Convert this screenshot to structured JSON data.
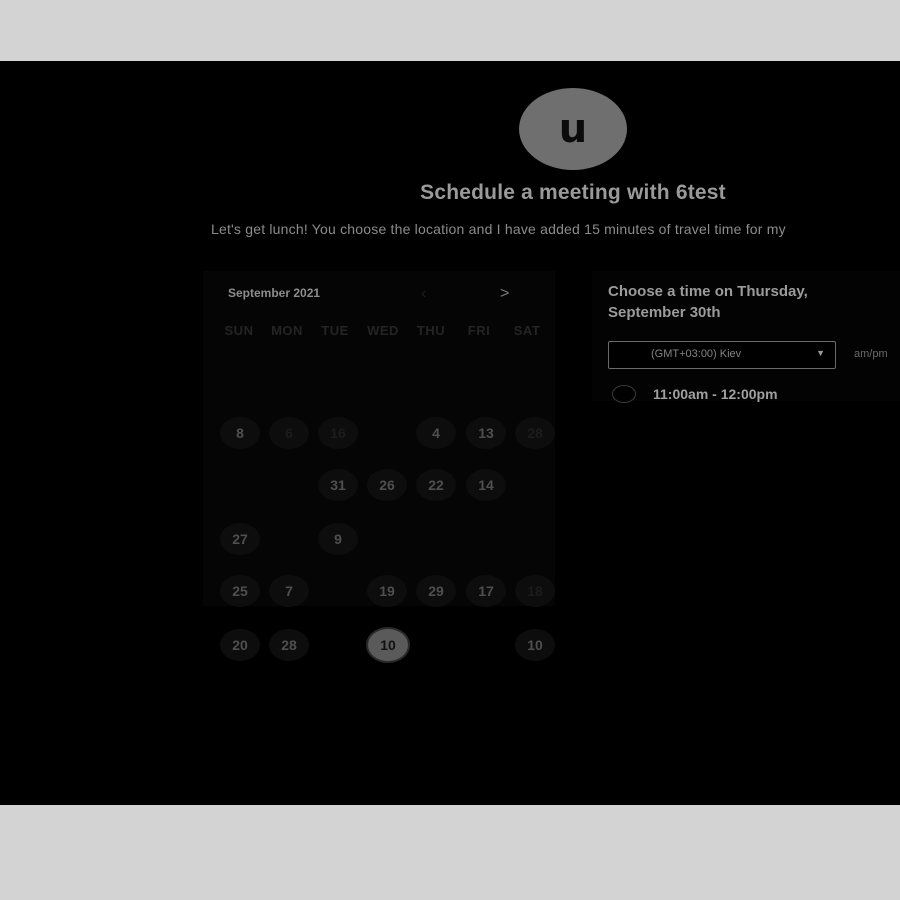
{
  "avatar": {
    "letter": "u"
  },
  "page": {
    "title": "Schedule a meeting with 6test",
    "description": "Let's get lunch! You choose the location and I have added 15 minutes of travel time for my"
  },
  "calendar": {
    "month_label": "September 2021",
    "prev_icon": "‹",
    "next_icon": ">",
    "weekdays": [
      "SUN",
      "MON",
      "TUE",
      "WED",
      "THU",
      "FRI",
      "SAT"
    ],
    "days": [
      [
        "8",
        "6",
        "16",
        "",
        "4",
        "13",
        "28"
      ],
      [
        "",
        "",
        "31",
        "26",
        "22",
        "14",
        ""
      ],
      [
        "27",
        "",
        "9",
        "",
        "",
        "",
        ""
      ],
      [
        "25",
        "7",
        "",
        "19",
        "29",
        "17",
        "18"
      ],
      [
        "20",
        "28",
        "",
        "10",
        "",
        "",
        "10"
      ]
    ],
    "selected_day": "10"
  },
  "time_picker": {
    "heading": "Choose a time on Thursday, September 30th",
    "timezone": "(GMT+03:00) Kiev",
    "format_toggle": "am/pm",
    "slots": [
      "11:00am - 12:00pm"
    ]
  },
  "colors": {
    "page_bg": "#d3d3d3",
    "stage_bg": "#000000",
    "avatar_bg": "#6f6f6f",
    "selected_day_bg": "#5a5a5a"
  }
}
